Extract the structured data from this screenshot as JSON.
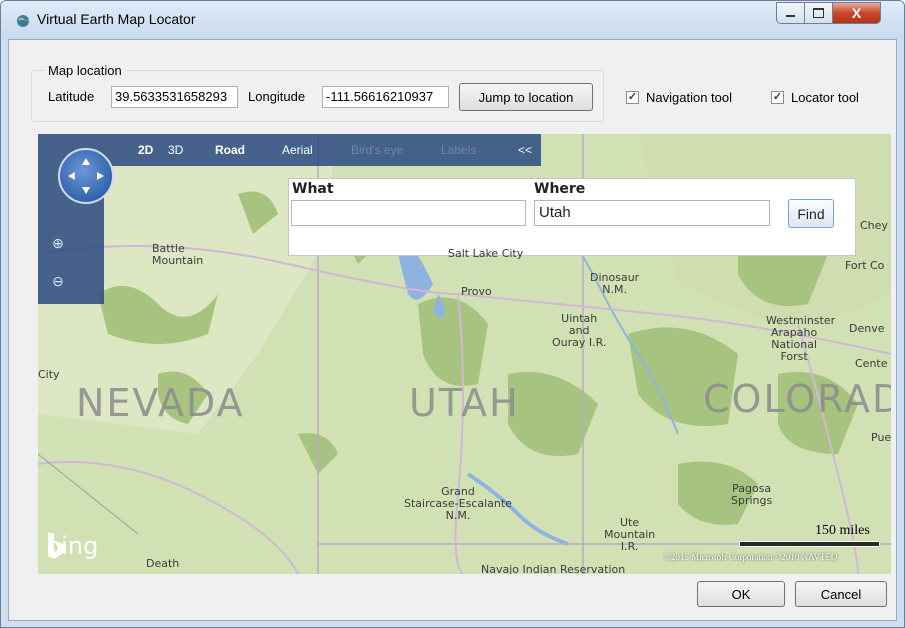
{
  "window": {
    "title": "Virtual Earth Map Locator",
    "close_glyph": "X"
  },
  "location_group": {
    "legend": "Map location",
    "latitude_label": "Latitude",
    "latitude_value": "39.5633531658293",
    "longitude_label": "Longitude",
    "longitude_value": "-111.56616210937",
    "jump_button": "Jump to location"
  },
  "checkboxes": [
    {
      "label": "Navigation tool",
      "checked": true
    },
    {
      "label": "Locator tool",
      "checked": true
    }
  ],
  "map": {
    "nav": {
      "mode_2d": "2D",
      "mode_3d": "3D",
      "road": "Road",
      "aerial": "Aerial",
      "birdseye": "Bird's eye",
      "labels": "Labels",
      "collapse": "<<"
    },
    "search": {
      "what_label": "What",
      "what_value": "",
      "where_label": "Where",
      "where_value": "Utah",
      "find_button": "Find"
    },
    "states": [
      "Nevada",
      "Utah",
      "Colorado"
    ],
    "places": {
      "battle_mountain": "Battle\nMountain",
      "salt_lake_city": "Salt Lake City",
      "provo": "Provo",
      "dinosaur": "Dinosaur\nN.M.",
      "uintah": "Uintah\nand\nOuray I.R.",
      "grand_staircase": "Grand\nStaircase-Escalante\nN.M.",
      "ute_mountain": "Ute\nMountain\nI.R.",
      "navajo": "Navajo Indian Reservation",
      "pagosa": "Pagosa\nSprings",
      "westminster": "Westminster",
      "arapaho": "Arapaho\nNational\nForst",
      "chey": "Chey",
      "fort_co": "Fort Co",
      "denve": "Denve",
      "cente": "Cente",
      "pue": "Pue",
      "city": "City",
      "death": "Death"
    },
    "brand": "bing",
    "scale": "150 miles",
    "copyright": "©2015 Microsoft Corporation ©2010 NAVTEQ",
    "colors": {
      "land": "#c6d9a4",
      "forest": "#a6c47f",
      "water": "#8fb3e0",
      "nav_bg": "#2c4a80"
    }
  },
  "footer": {
    "ok": "OK",
    "cancel": "Cancel"
  }
}
